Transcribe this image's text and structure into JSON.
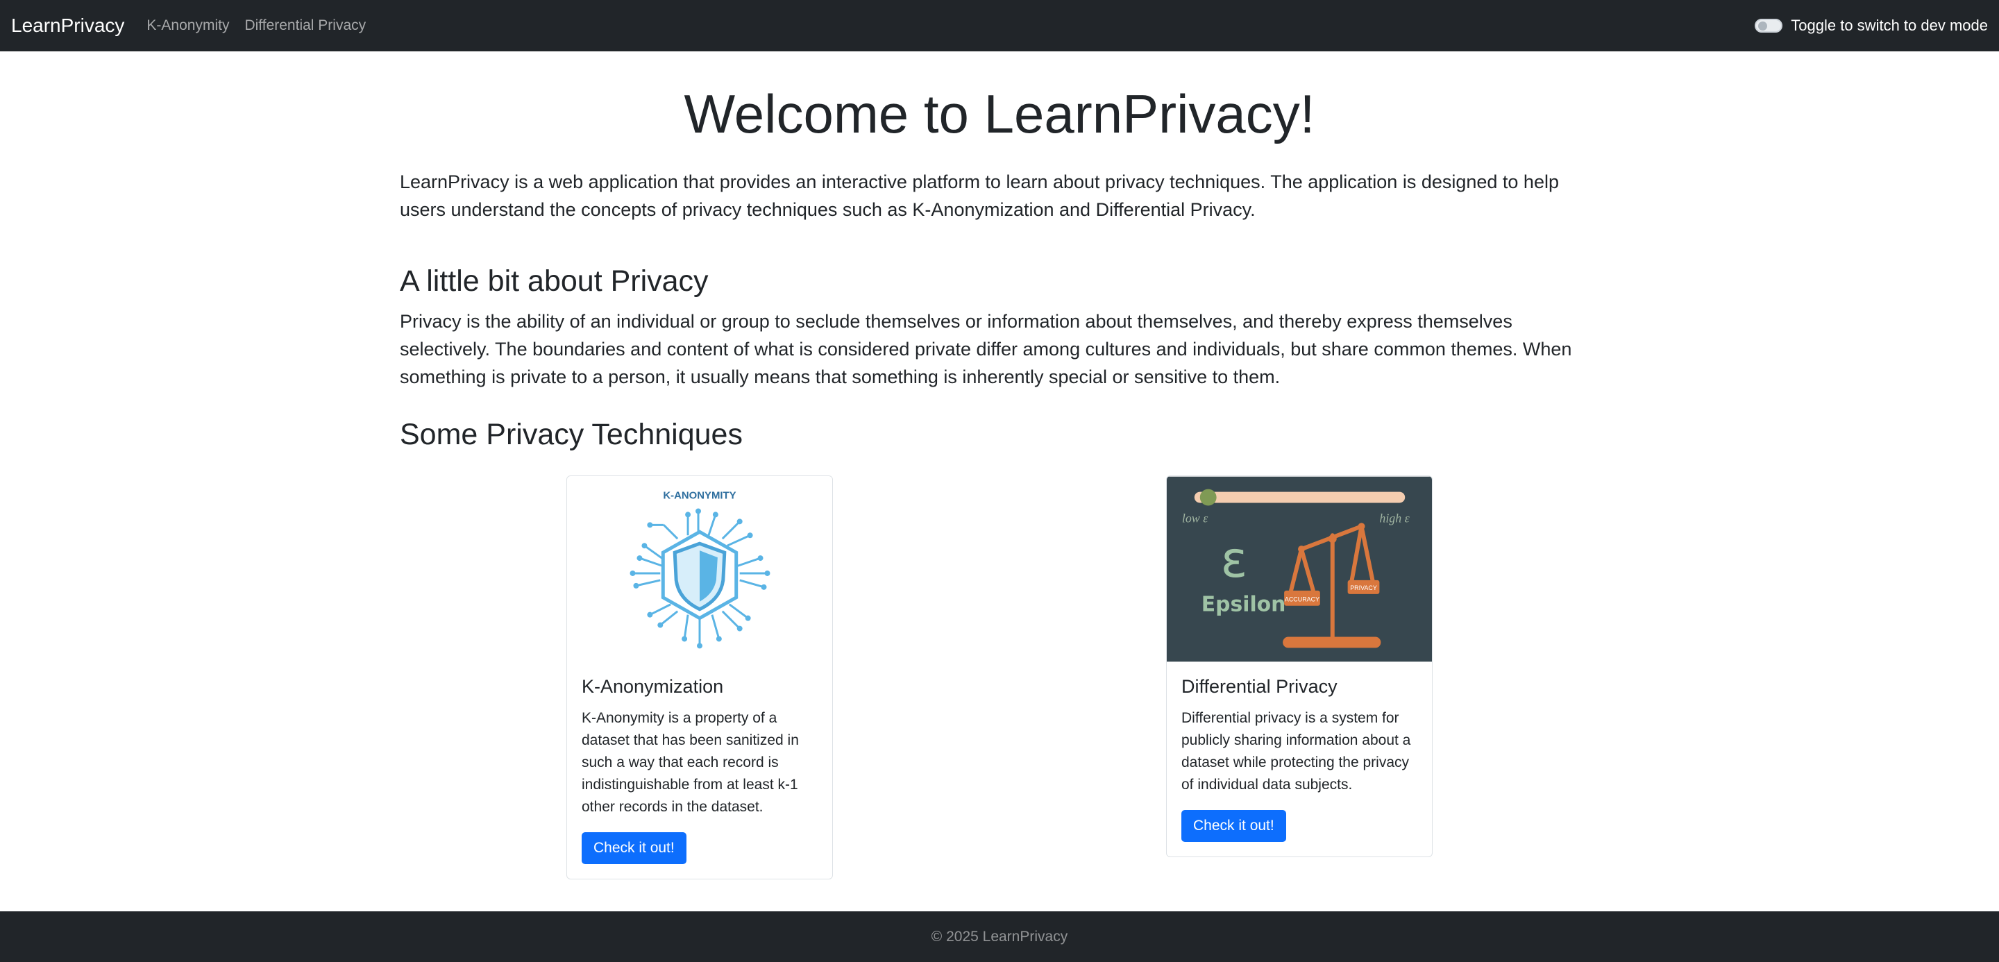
{
  "navbar": {
    "brand": "LearnPrivacy",
    "links": [
      "K-Anonymity",
      "Differential Privacy"
    ],
    "toggle_label": "Toggle to switch to dev mode"
  },
  "hero": {
    "title": "Welcome to LearnPrivacy!",
    "lead": "LearnPrivacy is a web application that provides an interactive platform to learn about privacy techniques. The application is designed to help users understand the concepts of privacy techniques such as K-Anonymization and Differential Privacy."
  },
  "about": {
    "heading": "A little bit about Privacy",
    "text": "Privacy is the ability of an individual or group to seclude themselves or information about themselves, and thereby express themselves selectively. The boundaries and content of what is considered private differ among cultures and individuals, but share common themes. When something is private to a person, it usually means that something is inherently special or sensitive to them."
  },
  "techniques": {
    "heading": "Some Privacy Techniques",
    "cards": [
      {
        "image_caption": "K-ANONYMITY",
        "title": "K-Anonymization",
        "text": "K-Anonymity is a property of a dataset that has been sanitized in such a way that each record is indistinguishable from at least k-1 other records in the dataset.",
        "button": "Check it out!"
      },
      {
        "image_labels": {
          "low": "low ε",
          "high": "high ε",
          "symbol": "ε",
          "word": "Epsilon",
          "left_pan": "ACCURACY",
          "right_pan": "PRIVACY"
        },
        "title": "Differential Privacy",
        "text": "Differential privacy is a system for publicly sharing information about a dataset while protecting the privacy of individual data subjects.",
        "button": "Check it out!"
      }
    ]
  },
  "footer": {
    "text": "© 2025 LearnPrivacy"
  },
  "colors": {
    "navbar_bg": "#212529",
    "primary": "#0d6efd",
    "kanon_blue": "#5ab4e5",
    "dp_bg": "#37474f",
    "dp_orange": "#d9773d"
  }
}
